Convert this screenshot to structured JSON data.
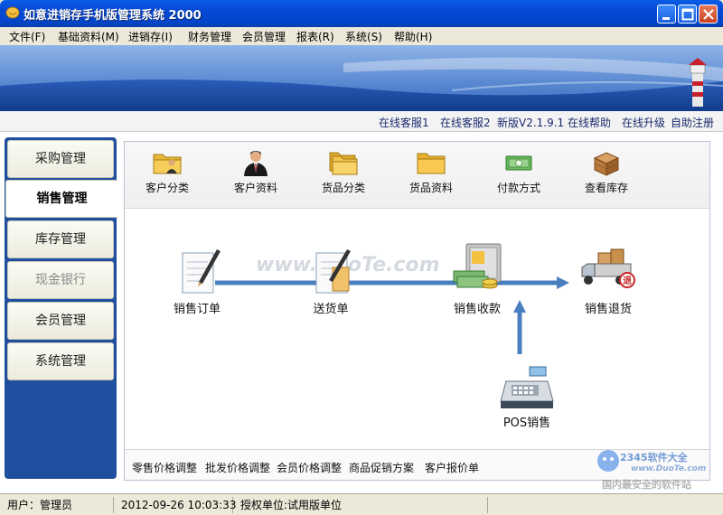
{
  "window": {
    "title": "如意进销存手机版管理系统  2000"
  },
  "menu": [
    "文件(F)",
    "基础资料(M)",
    "进销存(I)",
    "财务管理",
    "会员管理",
    "报表(R)",
    "系统(S)",
    "帮助(H)"
  ],
  "links": [
    "在线客服1",
    "在线客服2",
    "新版V2.1.9.1",
    "在线帮助",
    "在线升级",
    "自助注册"
  ],
  "nav": [
    "采购管理",
    "销售管理",
    "库存管理",
    "现金银行",
    "会员管理",
    "系统管理"
  ],
  "toolbar": [
    "客户分类",
    "客户资料",
    "货品分类",
    "货品资料",
    "付款方式",
    "查看库存"
  ],
  "flow": {
    "order": "销售订单",
    "delivery": "送货单",
    "receipt": "销售收款",
    "return": "销售退货",
    "pos": "POS销售",
    "return_badge": "退"
  },
  "bottom_links": [
    "零售价格调整",
    "批发价格调整",
    "会员价格调整",
    "商品促销方案",
    "客户报价单"
  ],
  "watermarks": {
    "main": "www.DuoTe.com",
    "corner_brand": "2345软件大全",
    "corner_url": "www.DuoTe.com",
    "corner_slogan": "国内最安全的软件站"
  },
  "status": {
    "user": "用户：管理员",
    "datetime": "2012-09-26 10:03:33",
    "license": "授权单位:试用版单位"
  },
  "colors": {
    "titlebar": "#0548d4",
    "nav": "#1f4f9e",
    "arrow": "#4a7fbf"
  }
}
